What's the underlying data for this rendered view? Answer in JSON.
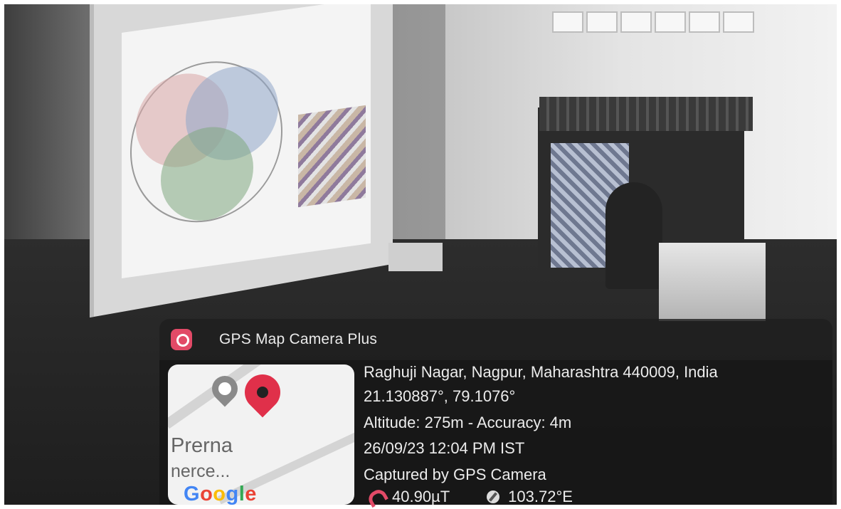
{
  "app": {
    "name": "GPS Map Camera Plus",
    "icon": "camera-pin-icon"
  },
  "map": {
    "place_label": "Prerna",
    "place_label_2": "nerce...",
    "provider_logo": "Google",
    "pin_icon": "map-pin-icon",
    "poi_icon": "school-pin-icon"
  },
  "location": {
    "address": "Raghuji Nagar, Nagpur, Maharashtra 440009, India",
    "coordinates": "21.130887°, 79.1076°",
    "altitude_accuracy": "Altitude: 275m - Accuracy: 4m",
    "datetime": "26/09/23 12:04 PM IST",
    "captured_by": "Captured by GPS Camera"
  },
  "sensors": {
    "magnetic_field": "40.90µT",
    "magnetic_icon": "magnet-icon",
    "heading": "103.72°E",
    "heading_icon": "compass-icon"
  },
  "colors": {
    "accent": "#e24a67",
    "overlay": "#1e1e1e"
  }
}
